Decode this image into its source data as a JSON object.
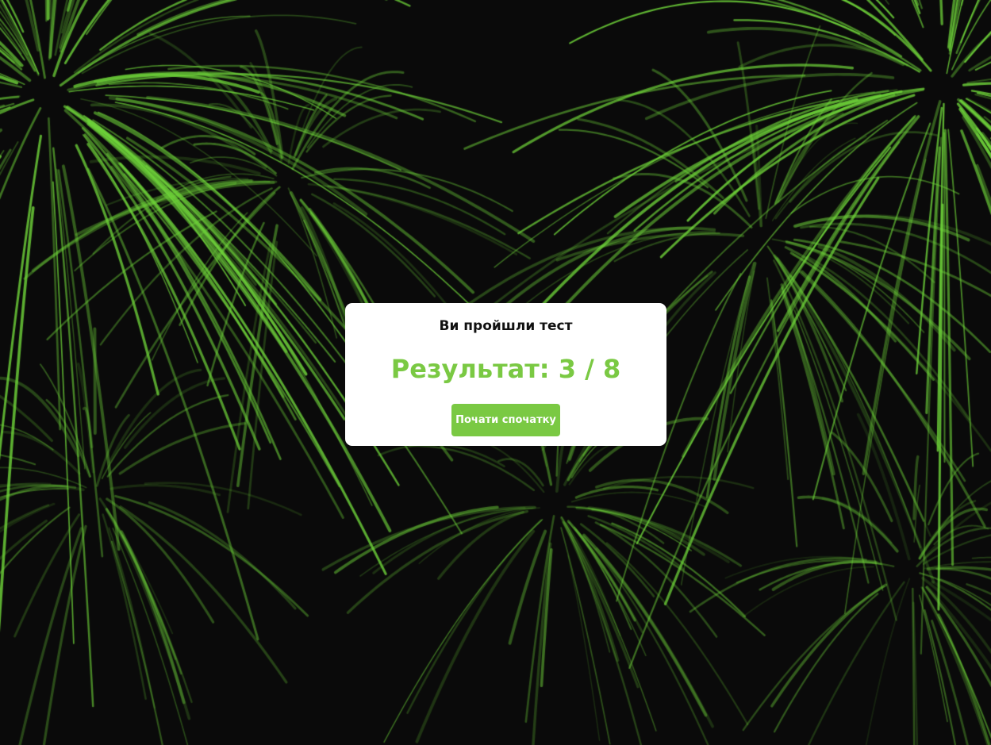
{
  "theme": {
    "accent": "#7ac943",
    "background": "#0a0a0a",
    "card": "#ffffff",
    "firework_color": "#6fd43a"
  },
  "background": {
    "animation": "fireworks-burst"
  },
  "result": {
    "heading": "Ви пройшли тест",
    "score_text": "Результат: 3 / 8",
    "correct": 3,
    "total": 8,
    "restart_label": "Почати спочатку"
  }
}
